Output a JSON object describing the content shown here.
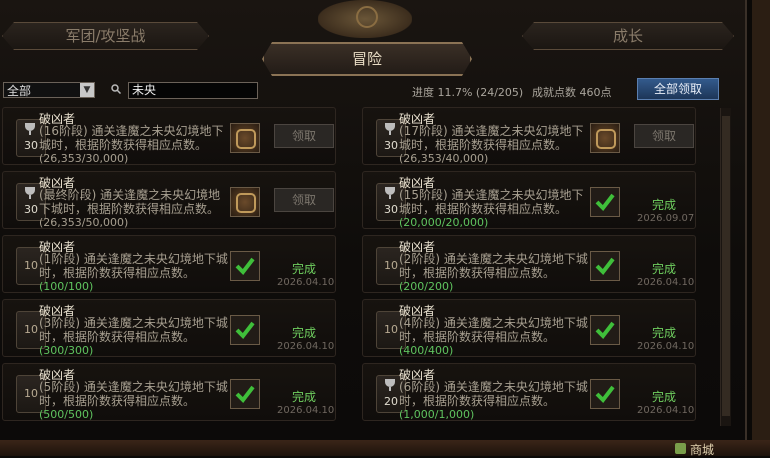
{
  "tabs": {
    "left": "军团/攻坚战",
    "right": "成长",
    "active": "冒险"
  },
  "toolbar": {
    "filter_value": "全部",
    "search_value": "未央",
    "progress": "进度 11.7% (24/205)",
    "points": "成就点数 460点",
    "claim_all": "全部领取"
  },
  "cards": [
    {
      "title": "破凶者",
      "desc": "(16阶段) 通关逢魔之未央幻境地下城时，根据阶数获得相应点数。",
      "count": "(26,353/30,000)",
      "medal": "30",
      "state": "claim",
      "button": "领取",
      "date": ""
    },
    {
      "title": "破凶者",
      "desc": "(17阶段) 通关逢魔之未央幻境地下城时，根据阶数获得相应点数。",
      "count": "(26,353/40,000)",
      "medal": "30",
      "state": "claim",
      "button": "领取",
      "date": ""
    },
    {
      "title": "破凶者",
      "desc": "(最终阶段) 通关逢魔之未央幻境地下城时，根据阶数获得相应点数。",
      "count": "(26,353/50,000)",
      "medal": "30",
      "state": "claim",
      "button": "领取",
      "date": ""
    },
    {
      "title": "破凶者",
      "desc": "(15阶段) 通关逢魔之未央幻境地下城时，根据阶数获得相应点数。",
      "count": "(20,000/20,000)",
      "medal": "30",
      "state": "done",
      "button": "完成",
      "date": "2026.09.07"
    },
    {
      "title": "破凶者",
      "desc": "(1阶段) 通关逢魔之未央幻境地下城时，根据阶数获得相应点数。",
      "count": "(100/100)",
      "medal": "10",
      "state": "done",
      "button": "完成",
      "date": "2026.04.10"
    },
    {
      "title": "破凶者",
      "desc": "(2阶段) 通关逢魔之未央幻境地下城时，根据阶数获得相应点数。",
      "count": "(200/200)",
      "medal": "10",
      "state": "done",
      "button": "完成",
      "date": "2026.04.10"
    },
    {
      "title": "破凶者",
      "desc": "(3阶段) 通关逢魔之未央幻境地下城时，根据阶数获得相应点数。",
      "count": "(300/300)",
      "medal": "10",
      "state": "done",
      "button": "完成",
      "date": "2026.04.10"
    },
    {
      "title": "破凶者",
      "desc": "(4阶段) 通关逢魔之未央幻境地下城时，根据阶数获得相应点数。",
      "count": "(400/400)",
      "medal": "10",
      "state": "done",
      "button": "完成",
      "date": "2026.04.10"
    },
    {
      "title": "破凶者",
      "desc": "(5阶段) 通关逢魔之未央幻境地下城时，根据阶数获得相应点数。",
      "count": "(500/500)",
      "medal": "10",
      "state": "done",
      "button": "完成",
      "date": "2026.04.10"
    },
    {
      "title": "破凶者",
      "desc": "(6阶段) 通关逢魔之未央幻境地下城时，根据阶数获得相应点数。",
      "count": "(1,000/1,000)",
      "medal": "20",
      "state": "done",
      "button": "完成",
      "date": "2026.04.10"
    }
  ],
  "taskbar": {
    "shop": "商城"
  },
  "colors": {
    "done_green": "#6fcf5f",
    "accent_blue": "#335a8c",
    "gold_border": "#8b7355"
  }
}
